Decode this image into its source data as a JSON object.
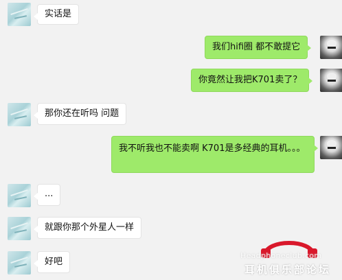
{
  "messages": [
    {
      "side": "left",
      "text": "实话是"
    },
    {
      "side": "right",
      "text": "我们hifi圈 都不敢提它"
    },
    {
      "side": "right",
      "text": "你竟然让我把K701卖了？"
    },
    {
      "side": "left",
      "text": "那你还在听吗 问题"
    },
    {
      "side": "right",
      "text": "我不听我也不能卖啊 K701是多经典的耳机。。。"
    },
    {
      "side": "left",
      "text": "..."
    },
    {
      "side": "left",
      "text": "就跟你那个外星人一样"
    },
    {
      "side": "left",
      "text": "好吧"
    }
  ],
  "watermark": {
    "site": "Headphoneclub.com",
    "name": "耳机俱乐部论坛",
    "logo_icon": "headphones-icon",
    "logo_color": "#d9182b"
  },
  "colors": {
    "sent_bubble": "#9eea6a",
    "received_bubble": "#ffffff",
    "background": "#f2f2f2"
  }
}
